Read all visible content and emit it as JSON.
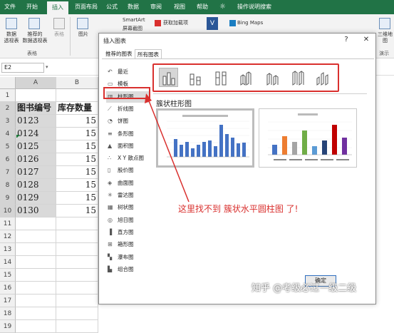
{
  "ribbon": {
    "tabs": [
      "文件",
      "开始",
      "插入",
      "页面布局",
      "公式",
      "数据",
      "审阅",
      "视图",
      "帮助",
      "操作说明搜索"
    ],
    "active_tab": "插入",
    "buttons": {
      "pivot": "数据\n透视表",
      "recommended_pivot": "推荐的\n数据透视表",
      "table": "表格",
      "pictures": "图片",
      "smartart": "SmartArt",
      "screenshot": "屏幕截图",
      "addins": "获取加载项",
      "bing": "Bing Maps",
      "threed_map": "三维地\n图"
    },
    "group_tables": "表格",
    "group_tours": "演示"
  },
  "formula_bar": {
    "name_box": "E2"
  },
  "sheet": {
    "columns": [
      "A",
      "B"
    ],
    "rows": [
      "1",
      "2",
      "3",
      "4",
      "5",
      "6",
      "7",
      "8",
      "9",
      "10",
      "11",
      "12",
      "13",
      "14",
      "15",
      "16",
      "17",
      "18",
      "19"
    ],
    "header": {
      "a": "图书编号",
      "b": "库存数量"
    },
    "data": [
      {
        "a": "0123",
        "b": "15"
      },
      {
        "a": "0124",
        "b": "15"
      },
      {
        "a": "0125",
        "b": "15"
      },
      {
        "a": "0126",
        "b": "15"
      },
      {
        "a": "0127",
        "b": "15"
      },
      {
        "a": "0128",
        "b": "15"
      },
      {
        "a": "0129",
        "b": "15"
      },
      {
        "a": "0130",
        "b": "15"
      }
    ]
  },
  "dialog": {
    "title": "插入图表",
    "help": "?",
    "close": "✕",
    "tabs": [
      "推荐的图表",
      "所有图表"
    ],
    "active_tab": "所有图表",
    "categories": [
      "最近",
      "模板",
      "柱形图",
      "折线图",
      "饼图",
      "条形图",
      "面积图",
      "X Y 散点图",
      "股价图",
      "曲面图",
      "雷达图",
      "树状图",
      "旭日图",
      "直方图",
      "箱形图",
      "瀑布图",
      "组合图"
    ],
    "category_icons": [
      "↶",
      "▭",
      "▥",
      "⟋",
      "◔",
      "≡",
      "▲",
      "∴",
      "▯",
      "◈",
      "✳",
      "▦",
      "◎",
      "▐",
      "⊞",
      "▚",
      "▙"
    ],
    "active_category": "柱形图",
    "subtitle": "簇状柱形图",
    "ok": "确定"
  },
  "annotation": "这里找不到 簇状水平圆柱图 了!",
  "watermark": "知乎 @考级必过一级二级",
  "colors": {
    "excel_green": "#217346",
    "annotation_red": "#d9302e",
    "bar_blue": "#4472c4"
  }
}
